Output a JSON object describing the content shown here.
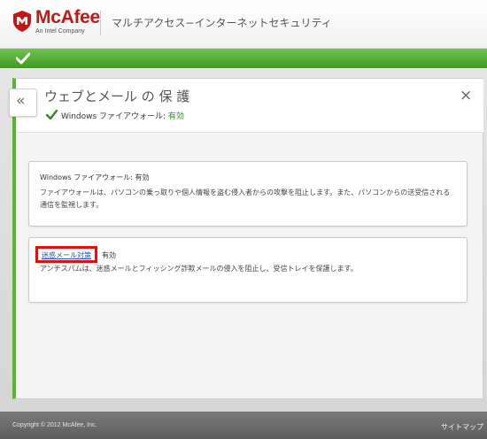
{
  "header": {
    "brand": "McAfee",
    "brand_sub": "An Intel Company",
    "product": "マルチアクセス−インターネットセキュリティ"
  },
  "status": {
    "icon": "check-icon",
    "color": "#4caf2f"
  },
  "panel": {
    "back": "«",
    "title": "ウェブとメール の 保 護",
    "close": "×",
    "firewall_label": "Windows ファイアウォール: ",
    "firewall_state": "有効"
  },
  "cards": {
    "firewall": {
      "title": "Windows ファイアウォール: 有効",
      "desc": "ファイアウォールは、パソコンの乗っ取りや個人情報を盗む侵入者からの攻撃を阻止します。また、パソコンからの送受信される通信を監視します。"
    },
    "spam": {
      "link": "迷惑メール対策",
      "state": "有効",
      "desc": "アンチスパムは、迷惑メールとフィッシング詐欺メールの侵入を阻止し、受信トレイを保護します。"
    }
  },
  "footer": {
    "copyright": "Copyright © 2012 McAfee, Inc.",
    "sitemap": "サイトマップ"
  },
  "colors": {
    "accent_green": "#5ab530",
    "brand_red": "#c01818",
    "highlight_red": "#e01010",
    "link_blue": "#1d58c4"
  }
}
